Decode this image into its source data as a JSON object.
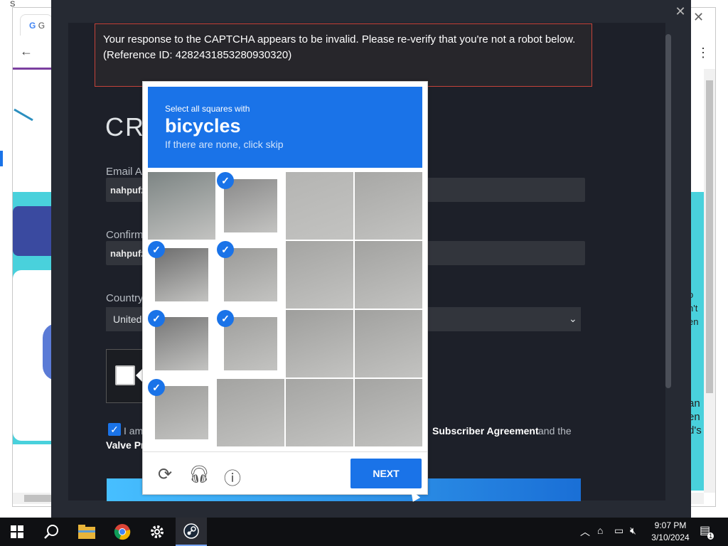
{
  "browser": {
    "tab_title": "G",
    "top_text": "S",
    "right_text_1": "o\nn't\nen",
    "right_text_2": "an\nen\nd's"
  },
  "steam": {
    "page_title": "CRE",
    "email_label": "Email Ad",
    "email_value": "nahpufz",
    "confirm_label": "Confirm",
    "confirm_value": "nahpufz",
    "country_label": "Country",
    "country_value": "United",
    "agree_prefix": "I am",
    "agree_link1": "Subscriber Agreement",
    "agree_mid": "and the",
    "agree_link2": "Valve Pr",
    "error_line1": "Your response to the CAPTCHA appears to be invalid. Please re-verify that you're not a robot below.",
    "error_line2": "(Reference ID: 4282431853280930320)"
  },
  "recaptcha": {
    "instruction": "Select all squares with",
    "target": "bicycles",
    "skip_hint": "If there are none, click skip",
    "next_label": "NEXT",
    "tiles": [
      {
        "row": 0,
        "col": 0,
        "selected": false,
        "tone": "#7d8584"
      },
      {
        "row": 0,
        "col": 1,
        "selected": true,
        "tone": "#8a8a8a"
      },
      {
        "row": 0,
        "col": 2,
        "selected": false,
        "tone": "#b4b4b2"
      },
      {
        "row": 0,
        "col": 3,
        "selected": false,
        "tone": "#a7a7a5"
      },
      {
        "row": 1,
        "col": 0,
        "selected": true,
        "tone": "#6e6e6e"
      },
      {
        "row": 1,
        "col": 1,
        "selected": true,
        "tone": "#9a9a98"
      },
      {
        "row": 1,
        "col": 2,
        "selected": false,
        "tone": "#a4a4a2"
      },
      {
        "row": 1,
        "col": 3,
        "selected": false,
        "tone": "#a2a2a0"
      },
      {
        "row": 2,
        "col": 0,
        "selected": true,
        "tone": "#777777"
      },
      {
        "row": 2,
        "col": 1,
        "selected": true,
        "tone": "#a0a09e"
      },
      {
        "row": 2,
        "col": 2,
        "selected": false,
        "tone": "#9e9e9c"
      },
      {
        "row": 2,
        "col": 3,
        "selected": false,
        "tone": "#a1a19f"
      },
      {
        "row": 3,
        "col": 0,
        "selected": true,
        "tone": "#9c9c9a"
      },
      {
        "row": 3,
        "col": 1,
        "selected": false,
        "tone": "#a3a3a1"
      },
      {
        "row": 3,
        "col": 2,
        "selected": false,
        "tone": "#a5a5a3"
      },
      {
        "row": 3,
        "col": 3,
        "selected": false,
        "tone": "#a4a4a2"
      }
    ]
  },
  "taskbar": {
    "time": "9:07 PM",
    "date": "3/10/2024",
    "notification_count": "1"
  },
  "colors": {
    "accent": "#1a73e8",
    "error_border": "#c5433a",
    "steam_bg": "#1d2029"
  }
}
